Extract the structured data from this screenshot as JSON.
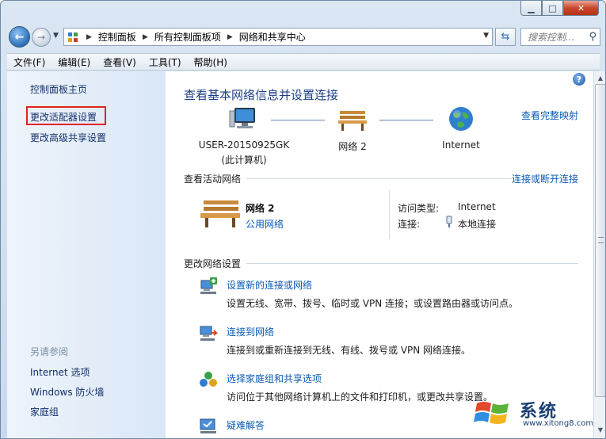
{
  "titlebar": {
    "minimize_icon": "minimize-icon",
    "maximize_icon": "maximize-icon",
    "close_icon": "close-icon"
  },
  "address": {
    "crumbs": [
      "控制面板",
      "所有控制面板项",
      "网络和共享中心"
    ],
    "search_placeholder": "搜索控制..."
  },
  "menu": {
    "items": [
      "文件(F)",
      "编辑(E)",
      "查看(V)",
      "工具(T)",
      "帮助(H)"
    ]
  },
  "sidebar": {
    "home": "控制面板主页",
    "change_adapter": "更改适配器设置",
    "change_sharing": "更改高级共享设置",
    "see_also": "另请参阅",
    "links": [
      "Internet 选项",
      "Windows 防火墙",
      "家庭组"
    ]
  },
  "main": {
    "title": "查看基本网络信息并设置连接",
    "full_map": "查看完整映射",
    "computer_name": "USER-20150925GK",
    "computer_note": "(此计算机)",
    "network_node": "网络  2",
    "internet_node": "Internet",
    "active_header": "查看活动网络",
    "connect_disconnect": "连接或断开连接",
    "active_network_name": "网络  2",
    "active_network_type": "公用网络",
    "access_type_label": "访问类型:",
    "access_type_value": "Internet",
    "connections_label": "连接:",
    "connections_value": "本地连接",
    "change_header": "更改网络设置",
    "tasks": [
      {
        "title": "设置新的连接或网络",
        "desc": "设置无线、宽带、拨号、临时或 VPN 连接；或设置路由器或访问点。"
      },
      {
        "title": "连接到网络",
        "desc": "连接到或重新连接到无线、有线、拨号或 VPN 网络连接。"
      },
      {
        "title": "选择家庭组和共享选项",
        "desc": "访问位于其他网络计算机上的文件和打印机，或更改共享设置。"
      },
      {
        "title": "疑难解答",
        "desc": ""
      }
    ]
  },
  "watermark": {
    "text": "系统",
    "url": "www.xitong8.com"
  },
  "colors": {
    "link": "#0b5bb7",
    "title": "#1d3f87",
    "highlight": "#e02424"
  }
}
